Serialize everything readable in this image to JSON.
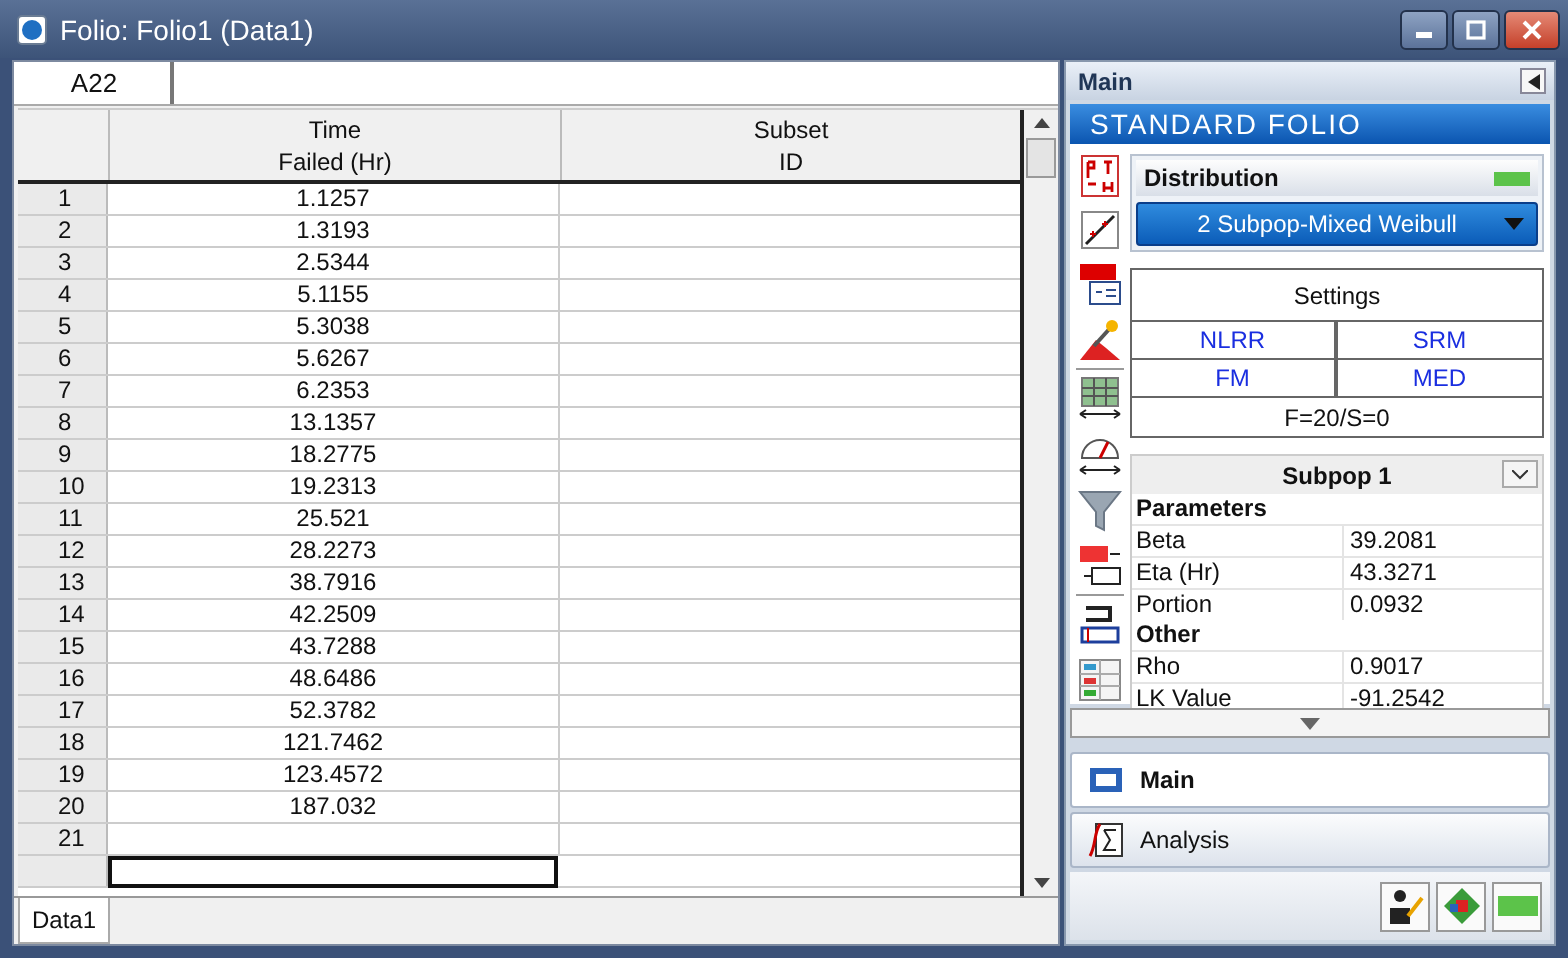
{
  "window": {
    "title": "Folio: Folio1 (Data1)"
  },
  "cell_ref": "A22",
  "columns": [
    {
      "line1": "Time",
      "line2": "Failed (Hr)"
    },
    {
      "line1": "Subset",
      "line2": "ID"
    }
  ],
  "rows": [
    {
      "num": "1",
      "time": "1.1257"
    },
    {
      "num": "2",
      "time": "1.3193"
    },
    {
      "num": "3",
      "time": "2.5344"
    },
    {
      "num": "4",
      "time": "5.1155"
    },
    {
      "num": "5",
      "time": "5.3038"
    },
    {
      "num": "6",
      "time": "5.6267"
    },
    {
      "num": "7",
      "time": "6.2353"
    },
    {
      "num": "8",
      "time": "13.1357"
    },
    {
      "num": "9",
      "time": "18.2775"
    },
    {
      "num": "10",
      "time": "19.2313"
    },
    {
      "num": "11",
      "time": "25.521"
    },
    {
      "num": "12",
      "time": "28.2273"
    },
    {
      "num": "13",
      "time": "38.7916"
    },
    {
      "num": "14",
      "time": "42.2509"
    },
    {
      "num": "15",
      "time": "43.7288"
    },
    {
      "num": "16",
      "time": "48.6486"
    },
    {
      "num": "17",
      "time": "52.3782"
    },
    {
      "num": "18",
      "time": "121.7462"
    },
    {
      "num": "19",
      "time": "123.4572"
    },
    {
      "num": "20",
      "time": "187.032"
    },
    {
      "num": "21",
      "time": ""
    }
  ],
  "sheet_tabs": [
    {
      "label": "Data1",
      "selected": true
    }
  ],
  "panel": {
    "header": "Main",
    "banner": "STANDARD FOLIO"
  },
  "distribution": {
    "title": "Distribution",
    "value": "2 Subpop-Mixed Weibull"
  },
  "settings": {
    "title": "Settings",
    "options": [
      "NLRR",
      "SRM",
      "FM",
      "MED"
    ],
    "summary": "F=20/S=0"
  },
  "subpop": {
    "title": "Subpop 1",
    "sections": [
      {
        "heading": "Parameters",
        "rows": [
          {
            "label": "Beta",
            "value": "39.2081"
          },
          {
            "label": "Eta (Hr)",
            "value": "43.3271"
          },
          {
            "label": "Portion",
            "value": "0.0932"
          }
        ]
      },
      {
        "heading": "Other",
        "rows": [
          {
            "label": "Rho",
            "value": "0.9017"
          },
          {
            "label": "LK Value",
            "value": "-91.2542"
          }
        ]
      }
    ]
  },
  "nav": [
    {
      "label": "Main",
      "selected": true
    },
    {
      "label": "Analysis",
      "selected": false
    }
  ]
}
